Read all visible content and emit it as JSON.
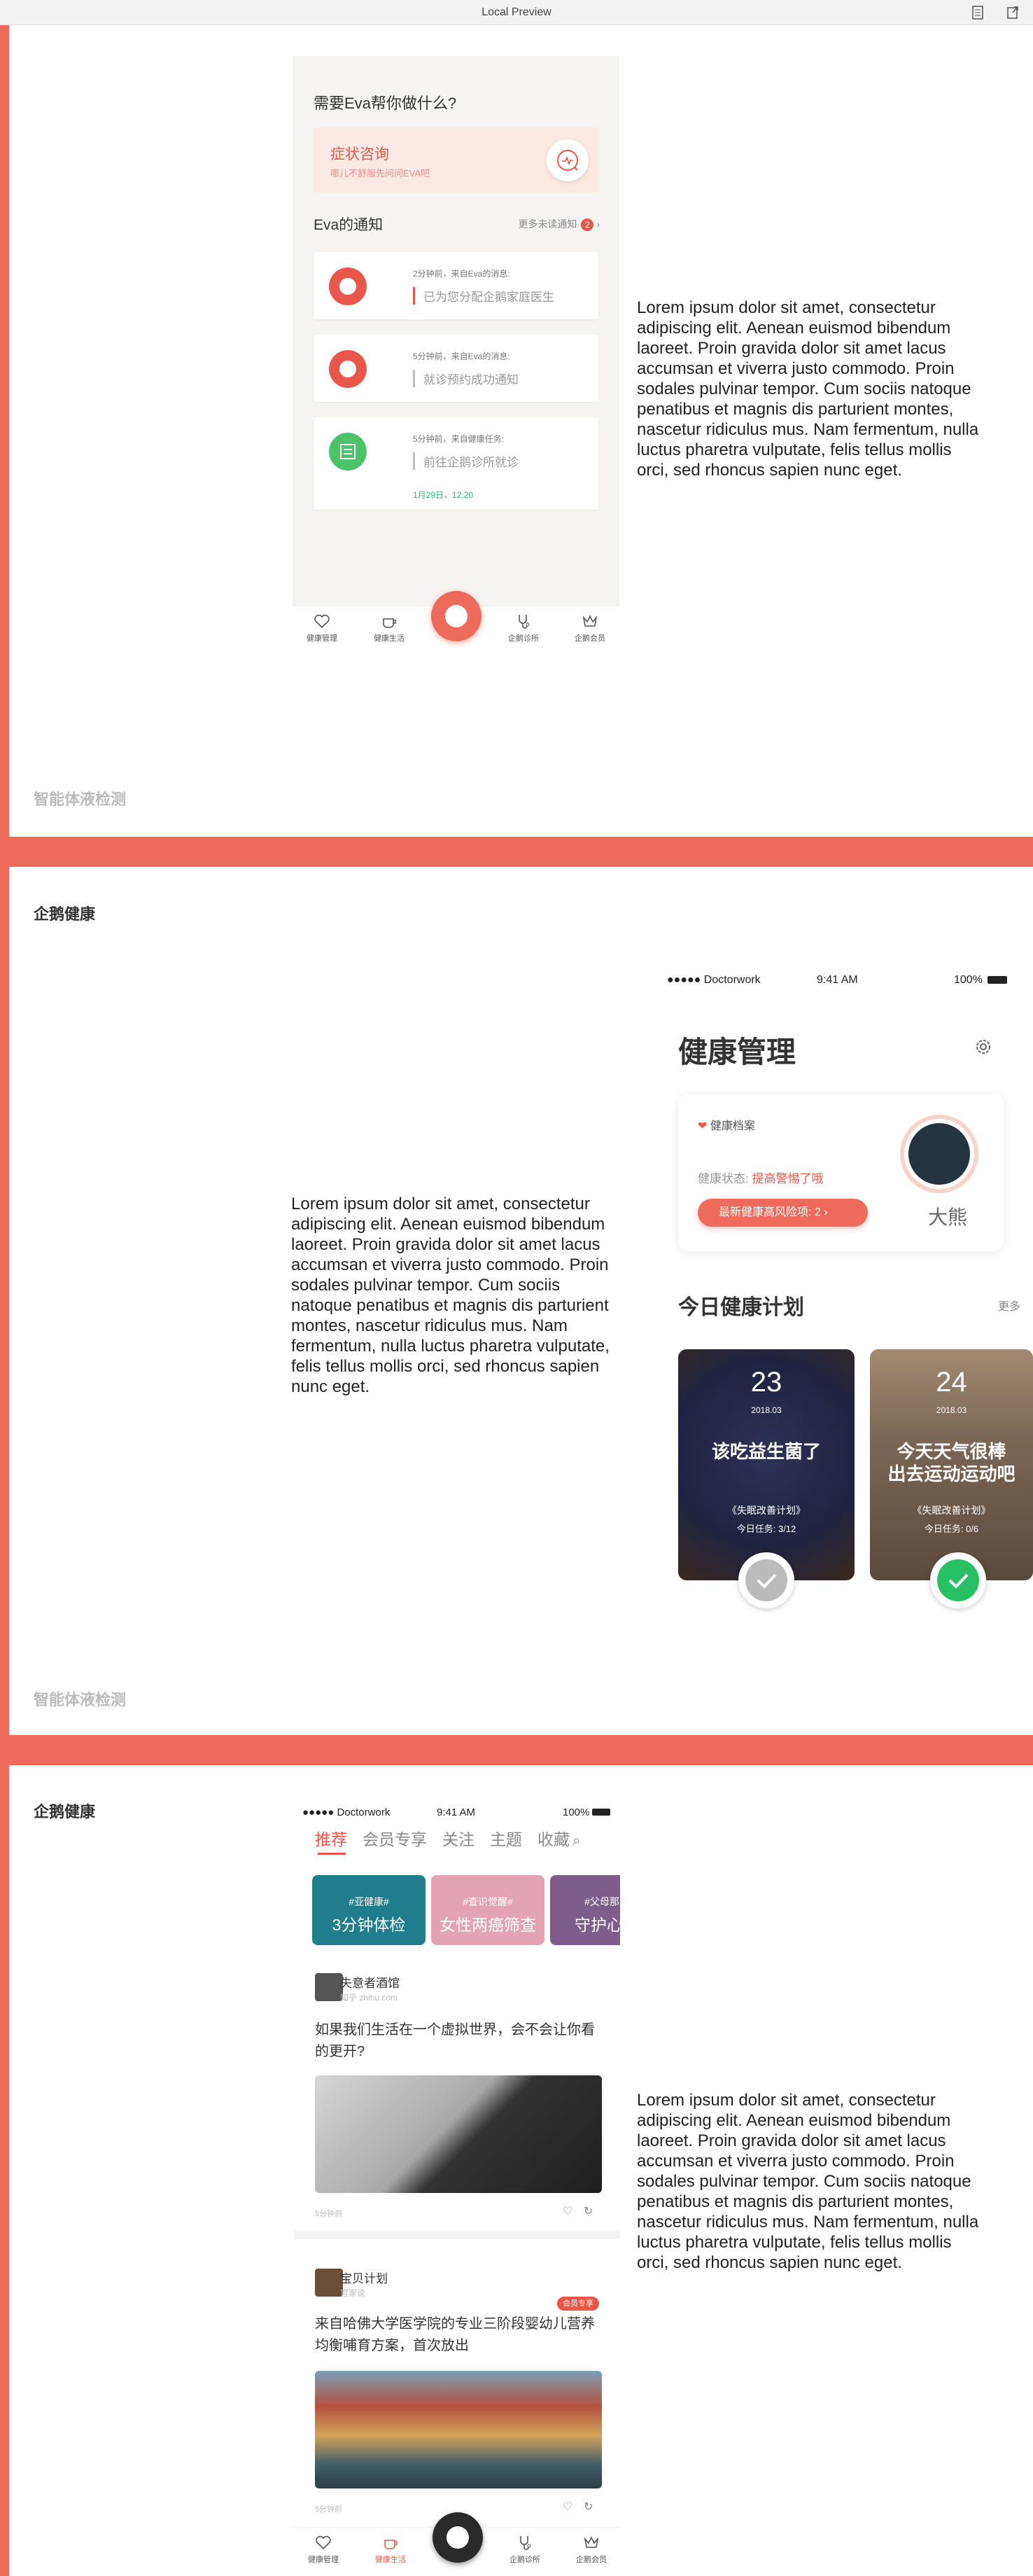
{
  "app": {
    "title": "Local Preview"
  },
  "captions": {
    "section1_footer": "智能体液检测",
    "section2_title": "企鹅健康",
    "section2_footer": "智能体液检测",
    "section3_title": "企鹅健康"
  },
  "lorem": "Lorem ipsum dolor sit amet, consectetur adipiscing elit. Aenean euismod bibendum laoreet. Proin gravida dolor sit amet lacus accumsan et viverra justo commodo. Proin sodales pulvinar tempor. Cum sociis natoque penatibus et magnis dis parturient montes, nascetur ridiculus mus. Nam fermentum, nulla luctus pharetra vulputate, felis tellus mollis orci, sed rhoncus sapien nunc eget.",
  "screen1": {
    "question": "需要Eva帮你做什么?",
    "symptom": {
      "title": "症状咨询",
      "sub": "哪儿不舒服先问问EVA吧"
    },
    "notices_title": "Eva的通知",
    "notices_more": "更多未读通知",
    "notices_count": "2",
    "cards": [
      {
        "meta": "2分钟前，来自Eva的消息:",
        "body": "已为您分配企鹅家庭医生"
      },
      {
        "meta": "5分钟前，来自Eva的消息:",
        "body": "就诊预约成功通知"
      },
      {
        "meta": "5分钟前，来自健康任务:",
        "body": "前往企鹅诊所就诊",
        "date": "1月29日，12:20"
      }
    ],
    "tabs": [
      "健康管理",
      "健康生活",
      "企鹅诊所",
      "企鹅会员"
    ]
  },
  "screen2": {
    "status": {
      "carrier": "●●●●● Doctorwork",
      "time": "9:41 AM",
      "battery": "100%"
    },
    "title": "健康管理",
    "profile": {
      "heading": "健康档案",
      "status_label": "健康状态: ",
      "status_value": "提高警惕了哦",
      "pill": "最新健康高风险项: 2",
      "name": "大熊"
    },
    "plan_title": "今日健康计划",
    "plan_more": "更多",
    "plans": [
      {
        "day": "23",
        "ym": "2018.03",
        "title": "该吃益生菌了",
        "plan": "《失眠改善计划》",
        "task": "今日任务: 3/12"
      },
      {
        "day": "24",
        "ym": "2018.03",
        "title": "今天天气很棒\n出去运动运动吧",
        "plan": "《失眠改善计划》",
        "task": "今日任务: 0/6"
      }
    ]
  },
  "screen3": {
    "status": {
      "carrier": "●●●●● Doctorwork",
      "time": "9:41 AM",
      "battery": "100%"
    },
    "tabs": [
      "推荐",
      "会员专享",
      "关注",
      "主题",
      "收藏"
    ],
    "tiles": [
      {
        "tag": "#亚健康#",
        "title": "3分钟体检",
        "color": "#1f7d8c"
      },
      {
        "tag": "#查识觉醒#",
        "title": "女性两癌筛查",
        "color": "#e4a3b4"
      },
      {
        "tag": "#父母那么",
        "title": "守护心脑",
        "color": "#7e5c8c"
      }
    ],
    "posts": [
      {
        "user": "失意者酒馆",
        "source": "知乎 zhihu.com",
        "text": "如果我们生活在一个虚拟世界，会不会让你看的更开?",
        "time": "5分钟前"
      },
      {
        "user": "宝贝计划",
        "source": "官家说",
        "badge": "会员专享",
        "text": "来自哈佛大学医学院的专业三阶段婴幼儿营养均衡哺育方案，首次放出",
        "time": "5分钟前"
      }
    ],
    "tabs_bottom": [
      "健康管理",
      "健康生活",
      "企鹅诊所",
      "企鹅会员"
    ]
  }
}
